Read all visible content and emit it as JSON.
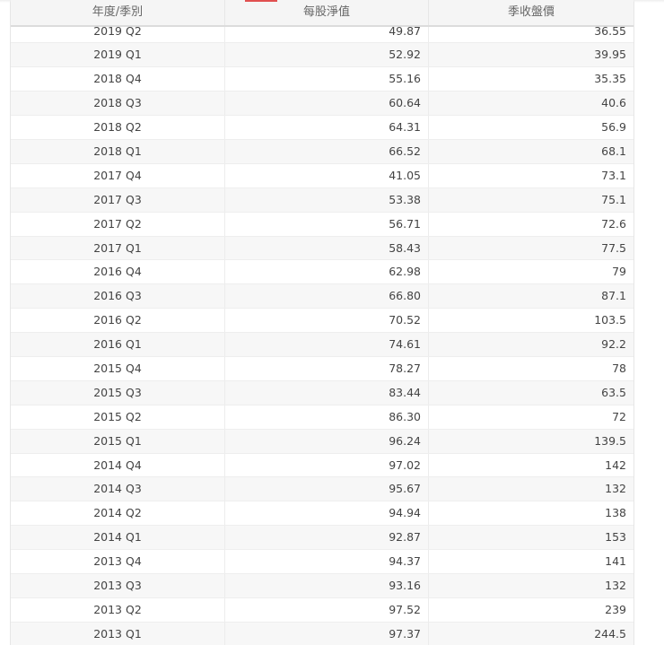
{
  "table": {
    "headers": [
      "年度/季別",
      "每股淨值",
      "季收盤價"
    ],
    "rows": [
      [
        "2019 Q2",
        "49.87",
        "36.55"
      ],
      [
        "2019 Q1",
        "52.92",
        "39.95"
      ],
      [
        "2018 Q4",
        "55.16",
        "35.35"
      ],
      [
        "2018 Q3",
        "60.64",
        "40.6"
      ],
      [
        "2018 Q2",
        "64.31",
        "56.9"
      ],
      [
        "2018 Q1",
        "66.52",
        "68.1"
      ],
      [
        "2017 Q4",
        "41.05",
        "73.1"
      ],
      [
        "2017 Q3",
        "53.38",
        "75.1"
      ],
      [
        "2017 Q2",
        "56.71",
        "72.6"
      ],
      [
        "2017 Q1",
        "58.43",
        "77.5"
      ],
      [
        "2016 Q4",
        "62.98",
        "79"
      ],
      [
        "2016 Q3",
        "66.80",
        "87.1"
      ],
      [
        "2016 Q2",
        "70.52",
        "103.5"
      ],
      [
        "2016 Q1",
        "74.61",
        "92.2"
      ],
      [
        "2015 Q4",
        "78.27",
        "78"
      ],
      [
        "2015 Q3",
        "83.44",
        "63.5"
      ],
      [
        "2015 Q2",
        "86.30",
        "72"
      ],
      [
        "2015 Q1",
        "96.24",
        "139.5"
      ],
      [
        "2014 Q4",
        "97.02",
        "142"
      ],
      [
        "2014 Q3",
        "95.67",
        "132"
      ],
      [
        "2014 Q2",
        "94.94",
        "138"
      ],
      [
        "2014 Q1",
        "92.87",
        "153"
      ],
      [
        "2013 Q4",
        "94.37",
        "141"
      ],
      [
        "2013 Q3",
        "93.16",
        "132"
      ],
      [
        "2013 Q2",
        "97.52",
        "239"
      ],
      [
        "2013 Q1",
        "97.37",
        "244.5"
      ]
    ]
  },
  "colors": {
    "accent": "#e05050"
  }
}
